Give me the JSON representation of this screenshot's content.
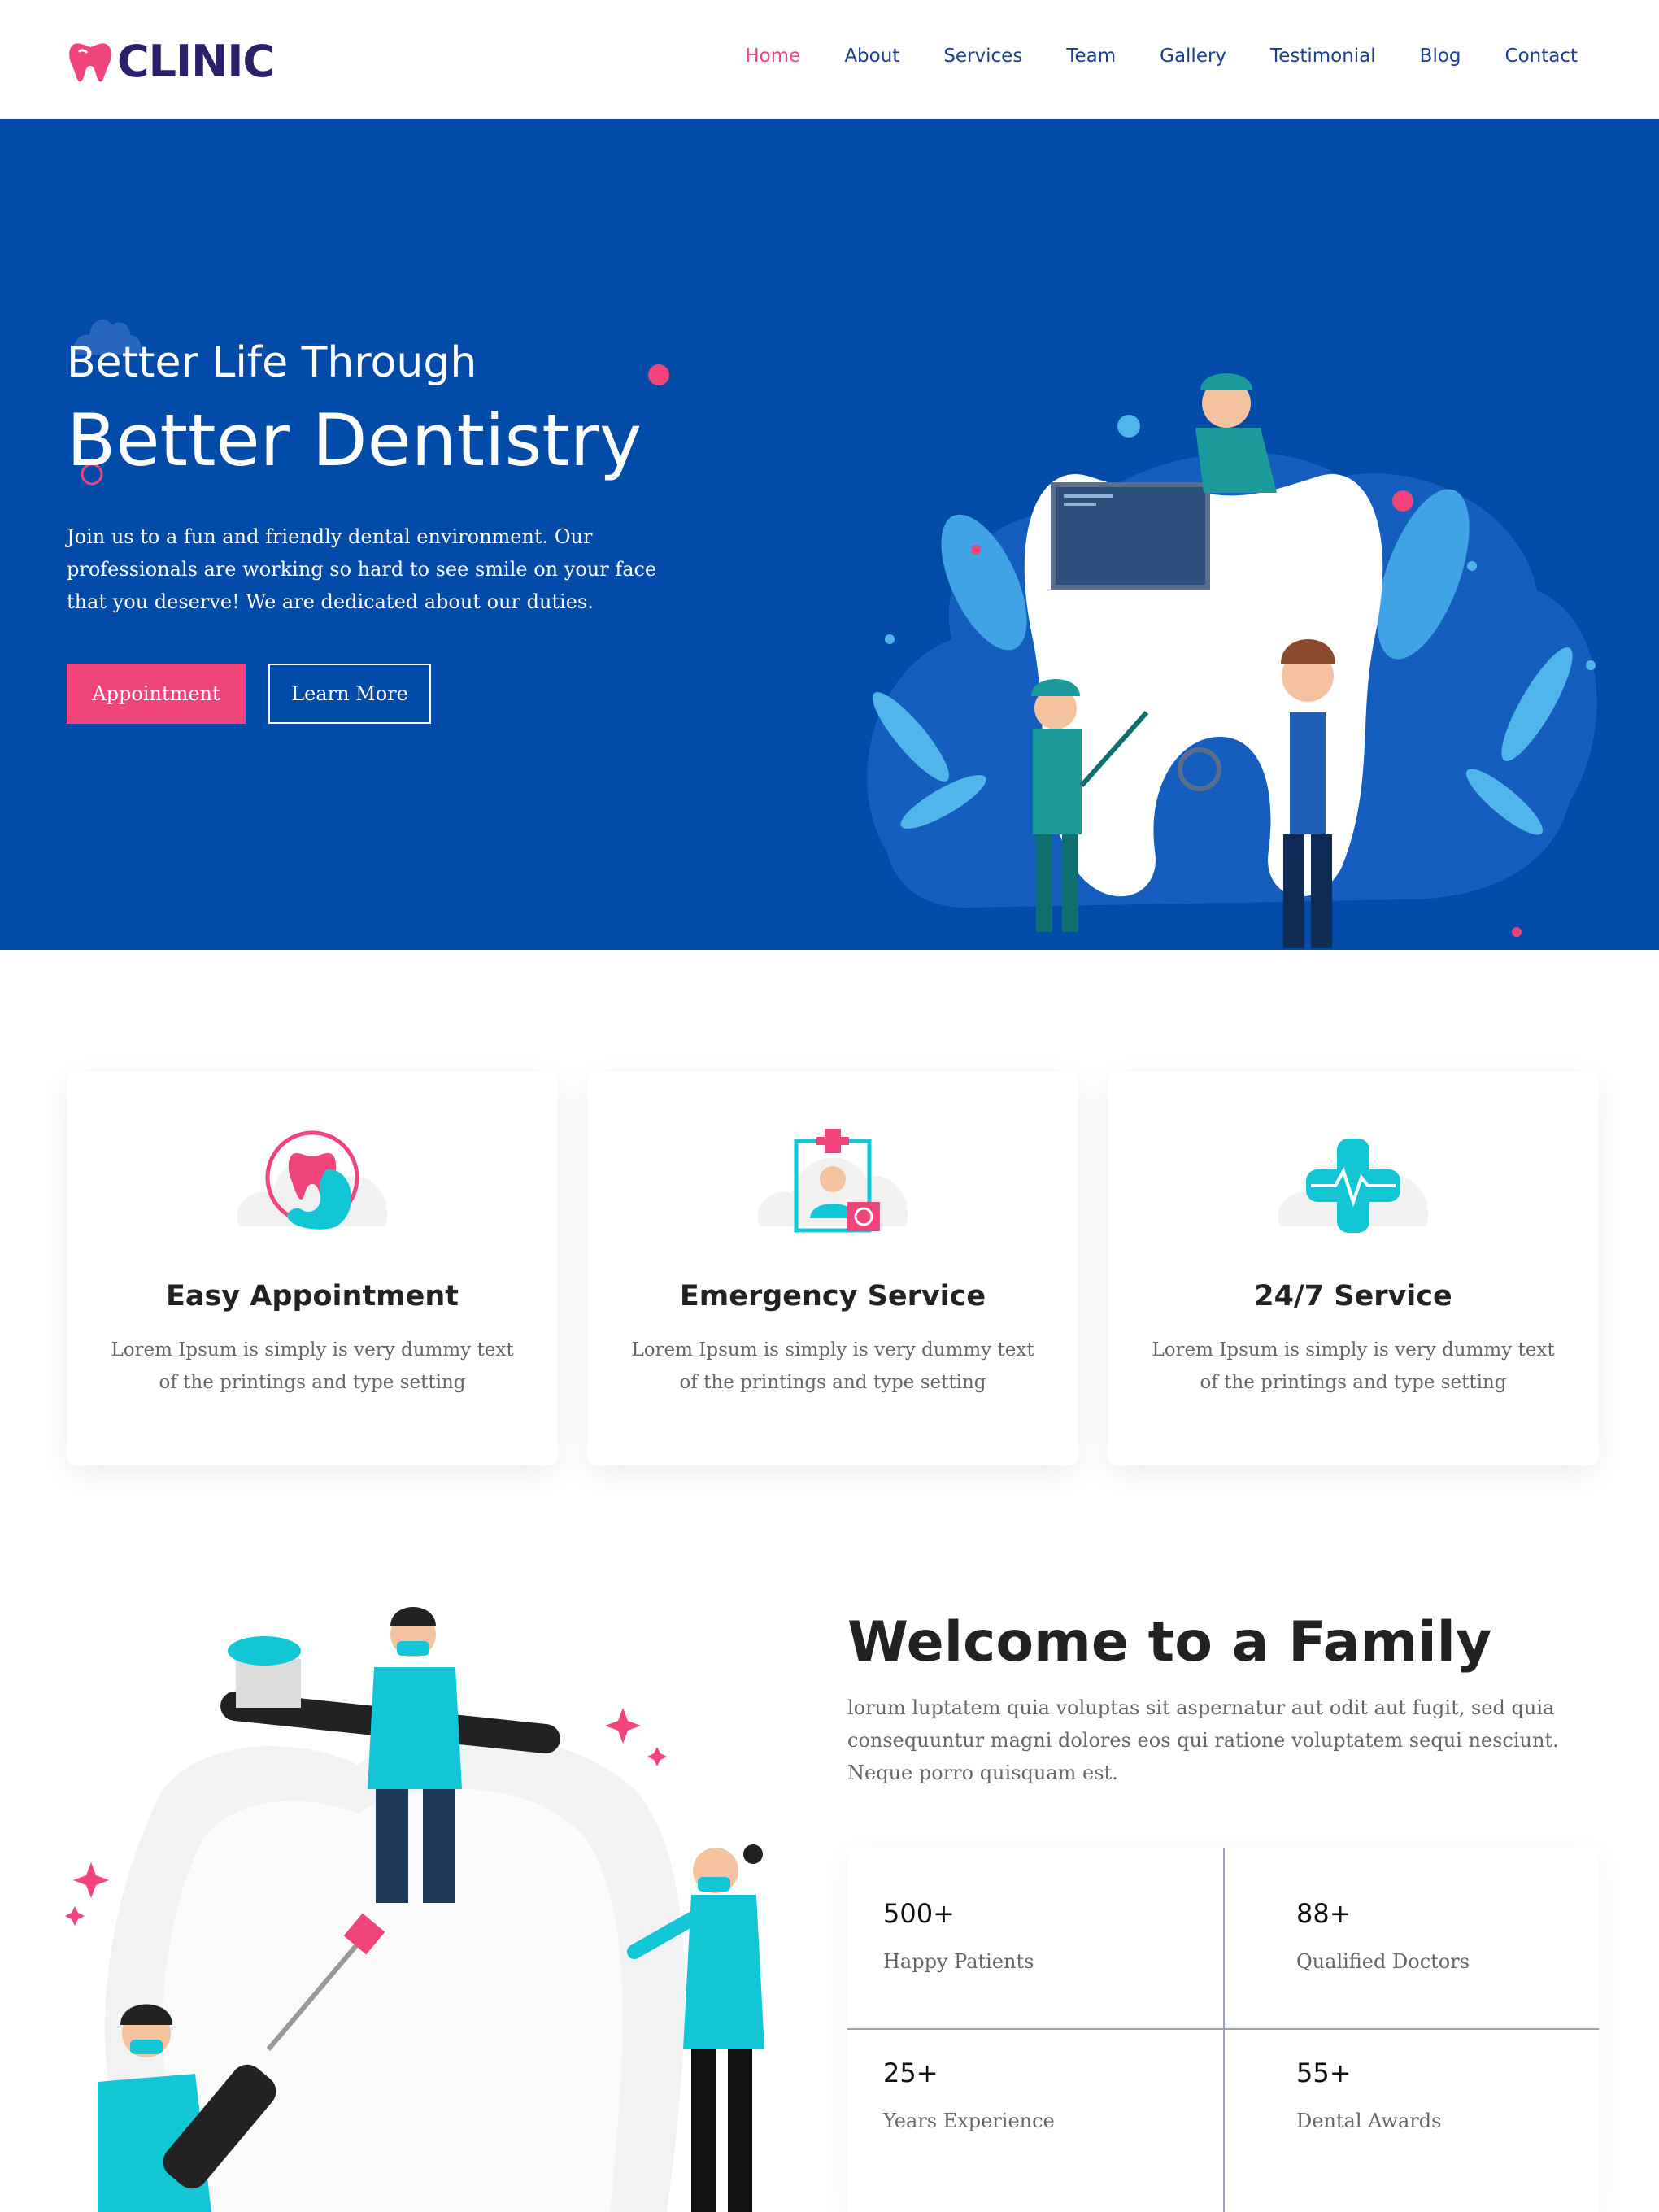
{
  "brand": {
    "name": "CLINIC",
    "icon": "tooth-icon"
  },
  "nav": {
    "items": [
      {
        "label": "Home",
        "active": true
      },
      {
        "label": "About"
      },
      {
        "label": "Services"
      },
      {
        "label": "Team"
      },
      {
        "label": "Gallery"
      },
      {
        "label": "Testimonial"
      },
      {
        "label": "Blog"
      },
      {
        "label": "Contact"
      }
    ]
  },
  "hero": {
    "subtitle": "Better Life Through",
    "title": "Better Dentistry",
    "text": "Join us to a fun and friendly dental environment. Our professionals are working so hard to see smile on your face that you deserve! We are dedicated about our duties.",
    "primary_button": "Appointment",
    "secondary_button": "Learn More"
  },
  "features": [
    {
      "icon": "phone-tooth-icon",
      "title": "Easy Appointment",
      "text": "Lorem Ipsum is simply is very dummy text of the printings and type setting"
    },
    {
      "icon": "doctor-id-icon",
      "title": "Emergency Service",
      "text": "Lorem Ipsum is simply is very dummy text of the printings and type setting"
    },
    {
      "icon": "medical-cross-icon",
      "title": "24/7 Service",
      "text": "Lorem Ipsum is simply is very dummy text of the printings and type setting"
    }
  ],
  "welcome": {
    "title": "Welcome to a Family",
    "text": "lorum luptatem quia voluptas sit aspernatur aut odit aut fugit, sed quia consequuntur magni dolores eos qui ratione voluptatem sequi nesciunt. Neque porro quisquam est."
  },
  "stats": [
    {
      "value": "500+",
      "label": "Happy Patients"
    },
    {
      "value": "88+",
      "label": "Qualified Doctors"
    },
    {
      "value": "25+",
      "label": "Years Experience"
    },
    {
      "value": "55+",
      "label": "Dental Awards"
    }
  ],
  "colors": {
    "primary": "#034ba9",
    "accent": "#f0447a",
    "teal": "#12c6d6",
    "nav": "#1d3d8f"
  }
}
